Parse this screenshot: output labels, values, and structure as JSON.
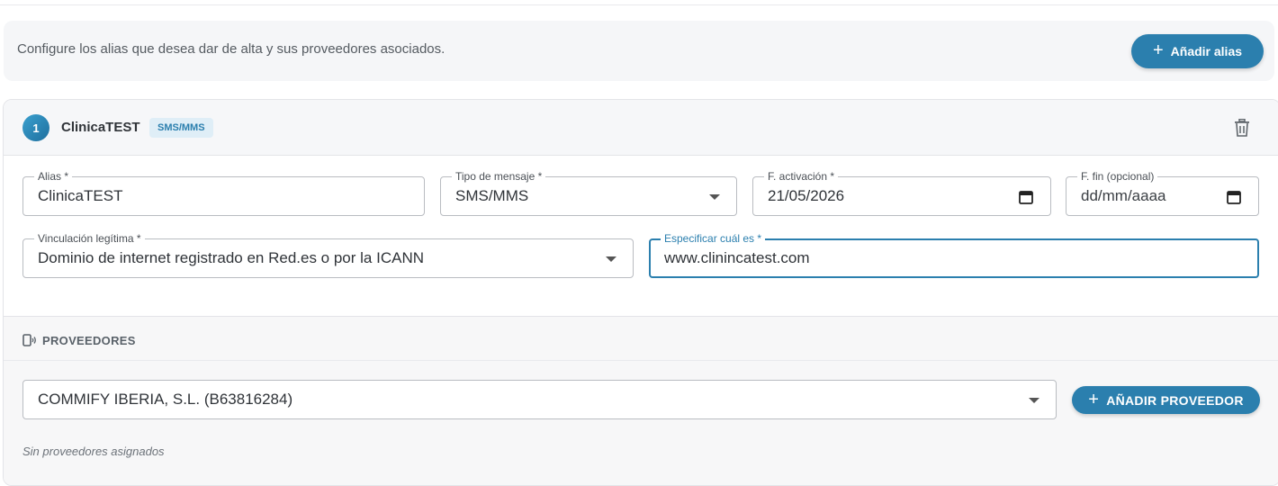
{
  "intro": {
    "text": "Configure los alias que desea dar de alta y sus proveedores asociados.",
    "add_alias_label": "Añadir alias",
    "add_alias_icon": "plus-icon"
  },
  "alias_card": {
    "number": "1",
    "title": "ClinicaTEST",
    "type_badge": "SMS/MMS",
    "delete_icon": "trash-icon",
    "fields": {
      "alias": {
        "label": "Alias *",
        "value": "ClinicaTEST"
      },
      "tipo_mensaje": {
        "label": "Tipo de mensaje *",
        "value": "SMS/MMS"
      },
      "f_activacion": {
        "label": "F. activación *",
        "value": "21/05/2026"
      },
      "f_fin": {
        "label": "F. fin (opcional)",
        "placeholder": "dd/mm/aaaa"
      },
      "vinculacion": {
        "label": "Vinculación legítima *",
        "value": "Dominio de internet registrado en Red.es o por la ICANN"
      },
      "especificar": {
        "label": "Especificar cuál es *",
        "value": "www.clinincatest.com"
      }
    }
  },
  "providers": {
    "title": "PROVEEDORES",
    "icon": "phone-signal-icon",
    "selected": "COMMIFY IBERIA, S.L. (B63816284)",
    "add_label": "AÑADIR PROVEEDOR",
    "empty_text": "Sin proveedores asignados"
  },
  "colors": {
    "accent": "#2b7fae",
    "panel_bg": "#f5f6f8",
    "border": "#b9bcc1"
  }
}
